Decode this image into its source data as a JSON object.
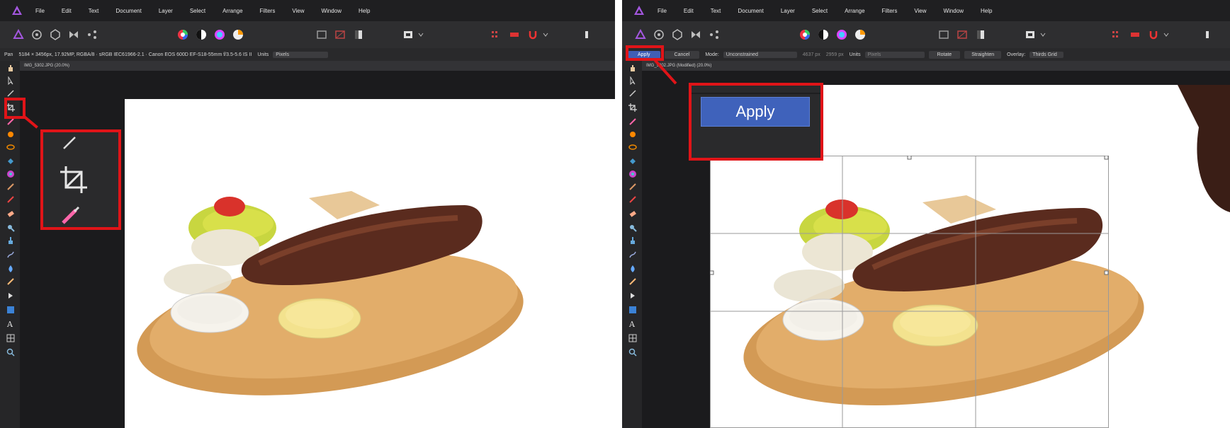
{
  "menu": [
    "File",
    "Edit",
    "Text",
    "Document",
    "Layer",
    "Select",
    "Arrange",
    "Filters",
    "View",
    "Window",
    "Help"
  ],
  "left": {
    "context_label": "Pan",
    "context_info": "5184 × 3456px, 17.92MP, RGBA/8 · sRGB IEC61966-2.1 · Canon EOS 600D EF-S18-55mm f/3.5-5.6 IS II",
    "units_label": "Units",
    "units_value": "Pixels",
    "doc_tab": "IMG_5302.JPG (20.0%)"
  },
  "right": {
    "apply_label": "Apply",
    "cancel_label": "Cancel",
    "mode_label": "Mode:",
    "mode_value": "Unconstrained",
    "width_value": "4637 px",
    "height_value": "2959 px",
    "units_label": "Units",
    "units_value": "Pixels",
    "rotate_label": "Rotate",
    "straighten_label": "Straighten",
    "overlay_label": "Overlay:",
    "overlay_value": "Thirds Grid",
    "doc_tab": "IMG_5302.JPG (Modified) (20.0%)",
    "zoom_apply_label": "Apply"
  },
  "colors": {
    "highlight": "#e01418",
    "accent": "#3f62bb",
    "logo": "#a457e0"
  }
}
